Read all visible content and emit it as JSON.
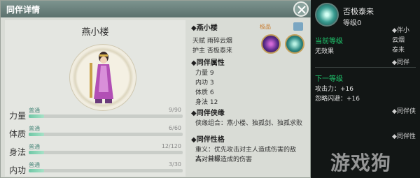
{
  "panel": {
    "title": "同伴详情",
    "character_name": "燕小楼"
  },
  "stats": [
    {
      "label": "力量",
      "quality": "普通",
      "value": "9/90",
      "fill": 0.1
    },
    {
      "label": "体质",
      "quality": "普通",
      "value": "6/60",
      "fill": 0.1
    },
    {
      "label": "身法",
      "quality": "普通",
      "value": "12/120",
      "fill": 0.1
    },
    {
      "label": "内功",
      "quality": "普通",
      "value": "3/30",
      "fill": 0.1
    }
  ],
  "info": {
    "name_head": "◆燕小楼",
    "rank_badge": "极品",
    "talent": "天赋  雨碎云烟",
    "guard": "护主  否极泰来",
    "attr_head": "◆同伴属性",
    "attrs": [
      "力量 9",
      "内功 3",
      "体质 6",
      "身法 12"
    ],
    "combo_head": "◆同伴侠缘",
    "combo": "侠缘组合：燕小楼、独孤剑、独孤求败",
    "personality_head": "◆同伴性格",
    "personality_line1": "重义：优先攻击对主人造成伤害的敌人，并提",
    "personality_line2": "高对目标造成的伤害"
  },
  "tooltip": {
    "skill_name": "否极泰来",
    "level": "等级0",
    "current_head": "当前等级",
    "current_effect": "无效果",
    "next_head": "下一等级",
    "next_line1": "攻击力：+16",
    "next_line2": "忽略闪避：+16",
    "icon": "swirl-skill-icon"
  },
  "side_strip": {
    "items": [
      "◆伴小",
      "云烟",
      "泰来",
      "◆同伴",
      "◆同伴侠",
      "◆同伴性"
    ]
  },
  "watermark": "游戏狗",
  "colors": {
    "accent_green": "#1fc76d",
    "bar_fill": "#6fc7a6",
    "badge_orange": "#c87a2b"
  }
}
